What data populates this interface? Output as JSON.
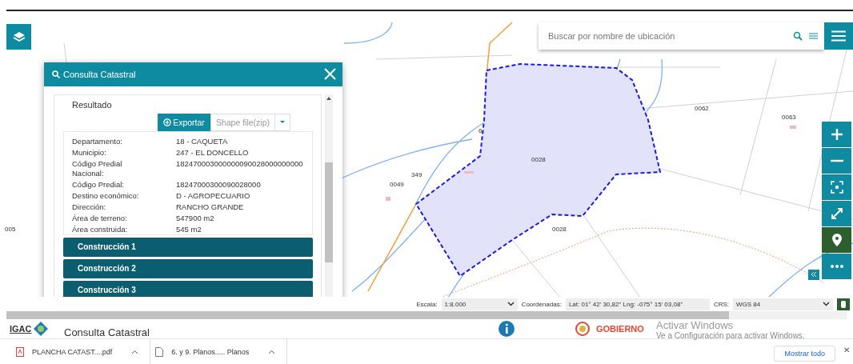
{
  "map": {
    "labels": [
      {
        "text": "0062"
      },
      {
        "text": "0063"
      },
      {
        "text": "0028"
      },
      {
        "text": "0028"
      },
      {
        "text": "0049"
      },
      {
        "text": "349"
      },
      {
        "text": "005"
      },
      {
        "text": "6"
      }
    ]
  },
  "search": {
    "placeholder": "Buscar por nombre de ubicación"
  },
  "panel": {
    "title": "Consulta Catastral",
    "section": "Resultado",
    "export_button": "Exportar",
    "format_select": "Shape file(zip)",
    "fields": [
      {
        "label": "Departamento:",
        "value": "18 - CAQUETA"
      },
      {
        "label": "Municipio:",
        "value": "247 - EL DONCELLO"
      },
      {
        "label": "Código Predial Nacional:",
        "value": "182470003000000090028000000000"
      },
      {
        "label": "Código Predial:",
        "value": "18247000300090028000"
      },
      {
        "label": "Destino económico:",
        "value": "D - AGROPECUARIO"
      },
      {
        "label": "Dirección:",
        "value": "RANCHO GRANDE"
      },
      {
        "label": "Área de terreno:",
        "value": "547900 m2"
      },
      {
        "label": "Área construida:",
        "value": "545 m2"
      }
    ],
    "constructions": [
      "Construcción 1",
      "Construcción 2",
      "Construcción 3"
    ]
  },
  "status_bar": {
    "scale_label": "Escala:",
    "scale": "1:8.000",
    "coords_label": "Coordenadas:",
    "coords": "Lat: 01° 42' 30,82\" Lng: -075° 15' 03,08\"",
    "crs_label": "CRS:",
    "crs": "WGS 84"
  },
  "footer": {
    "logo": "IGAC",
    "title": "Consulta Catastral",
    "government": "GOBIERNO"
  },
  "windows_notice": [
    "Activar Windows",
    "Ve a Configuración para activar Windows."
  ],
  "downloads": [
    {
      "name": "PLANCHA CATAST....pdf",
      "kind": "pdf"
    },
    {
      "name": "6. y 9. Planos..... Planos",
      "kind": "file"
    }
  ],
  "show_all": "Mostrar todo",
  "close_glyph": "✕"
}
